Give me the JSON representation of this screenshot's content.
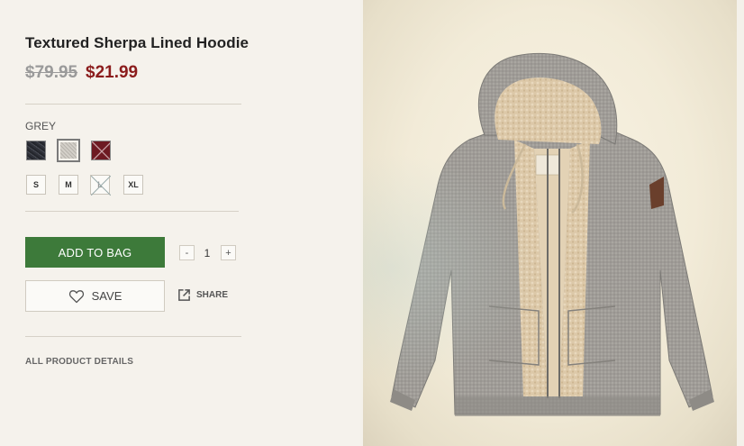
{
  "product": {
    "title": "Textured Sherpa Lined Hoodie",
    "original_price": "$79.95",
    "sale_price": "$21.99"
  },
  "colors": {
    "selected_label": "GREY",
    "swatches": [
      {
        "name": "charcoal",
        "available": true,
        "selected": false
      },
      {
        "name": "grey",
        "available": true,
        "selected": true
      },
      {
        "name": "burgundy",
        "available": false,
        "selected": false
      }
    ]
  },
  "sizes": [
    {
      "label": "S",
      "available": true
    },
    {
      "label": "M",
      "available": true
    },
    {
      "label": "L",
      "available": false
    },
    {
      "label": "XL",
      "available": true
    }
  ],
  "cart": {
    "add_label": "ADD TO BAG",
    "qty_minus": "-",
    "qty_value": "1",
    "qty_plus": "+"
  },
  "actions": {
    "save_label": "SAVE",
    "share_label": "SHARE",
    "save_icon": "heart-icon",
    "share_icon": "share-icon"
  },
  "details_link": "ALL PRODUCT DETAILS",
  "theme": {
    "accent_green": "#3d7a3a",
    "sale_red": "#8b1c1c",
    "page_bg": "#f5f2ec"
  }
}
